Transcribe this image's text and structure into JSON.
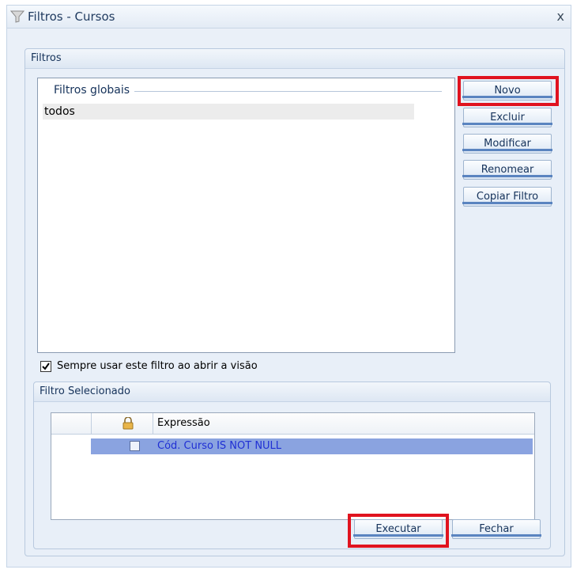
{
  "window": {
    "title": "Filtros - Cursos",
    "close_label": "x"
  },
  "filters_group": {
    "title": "Filtros",
    "list_caption": "Filtros globais",
    "items": [
      "todos"
    ]
  },
  "buttons": {
    "novo": "Novo",
    "excluir": "Excluir",
    "modificar": "Modificar",
    "renomear": "Renomear",
    "copiar_filtro": "Copiar Filtro"
  },
  "always_use": {
    "label": "Sempre usar este filtro ao abrir a visão",
    "checked": true
  },
  "selected_group": {
    "title": "Filtro Selecionado",
    "column_header": "Expressão",
    "rows": [
      {
        "expression": "Cód. Curso IS NOT NULL",
        "locked": false
      }
    ]
  },
  "footer": {
    "executar": "Executar",
    "fechar": "Fechar"
  },
  "colors": {
    "highlight": "#e0131f",
    "selected_row": "#8aa3e0",
    "title_text": "#1f3a5f"
  },
  "icons": {
    "window": "filter-icon",
    "lock": "lock-icon",
    "checkbox": "checkbox-icon"
  }
}
